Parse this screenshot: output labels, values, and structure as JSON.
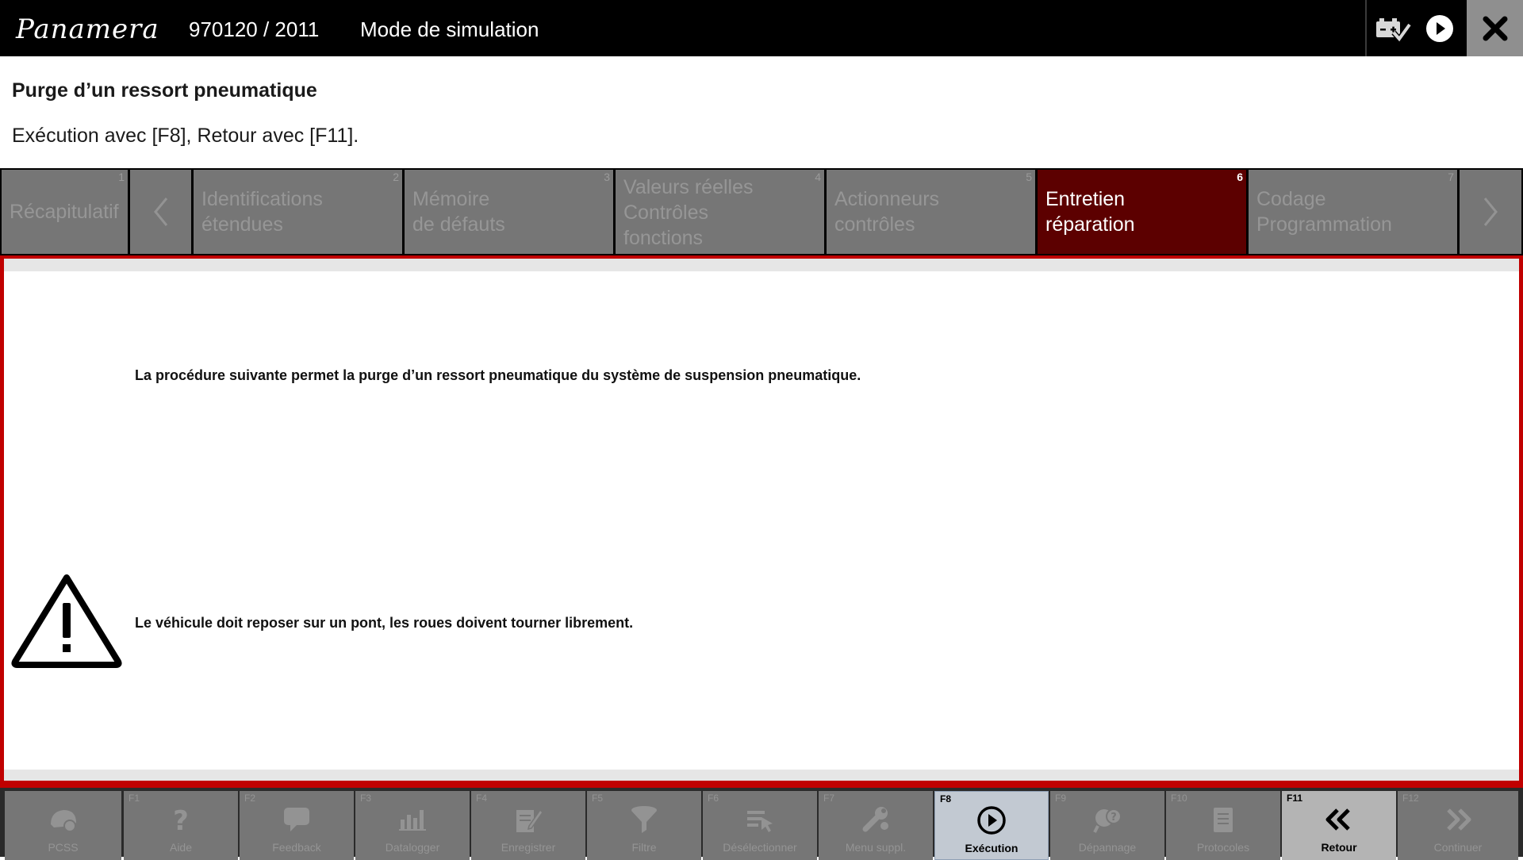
{
  "header": {
    "model_logo": "Panamera",
    "vehicle_id": "970120 / 2011",
    "mode": "Mode de simulation",
    "icons": [
      "battery-check-icon",
      "play-icon",
      "close-icon"
    ]
  },
  "page": {
    "title": "Purge d’un ressort pneumatique",
    "instruction": "Exécution avec [F8], Retour avec [F11]."
  },
  "tabs": [
    {
      "num": "1",
      "label": "Récapitulatif",
      "active": false
    },
    {
      "num": "2",
      "label": "Identifications\nétendues",
      "active": false
    },
    {
      "num": "3",
      "label": "Mémoire\nde défauts",
      "active": false
    },
    {
      "num": "4",
      "label": "Valeurs réelles\nContrôles\nfonctions",
      "active": false
    },
    {
      "num": "5",
      "label": "Actionneurs\ncontrôles",
      "active": false
    },
    {
      "num": "6",
      "label": "Entretien\nréparation",
      "active": true
    },
    {
      "num": "7",
      "label": "Codage\nProgrammation",
      "active": false
    }
  ],
  "content": {
    "procedure_text": "La procédure suivante permet la purge d’un ressort pneumatique du système de suspension pneumatique.",
    "warning_text": "Le véhicule doit reposer sur un pont, les roues doivent tourner librement."
  },
  "function_keys": [
    {
      "code": "",
      "label": "PCSS",
      "icon": "pcss-icon",
      "enabled": false
    },
    {
      "code": "F1",
      "label": "Aide",
      "icon": "help-icon",
      "enabled": false
    },
    {
      "code": "F2",
      "label": "Feedback",
      "icon": "feedback-icon",
      "enabled": false
    },
    {
      "code": "F3",
      "label": "Datalogger",
      "icon": "datalogger-icon",
      "enabled": false
    },
    {
      "code": "F4",
      "label": "Enregistrer",
      "icon": "save-icon",
      "enabled": false
    },
    {
      "code": "F5",
      "label": "Filtre",
      "icon": "filter-icon",
      "enabled": false
    },
    {
      "code": "F6",
      "label": "Désélectionner",
      "icon": "deselect-icon",
      "enabled": false
    },
    {
      "code": "F7",
      "label": "Menu suppl.",
      "icon": "extra-menu-icon",
      "enabled": false
    },
    {
      "code": "F8",
      "label": "Exécution",
      "icon": "execute-icon",
      "enabled": true
    },
    {
      "code": "F9",
      "label": "Dépannage",
      "icon": "troubleshoot-icon",
      "enabled": false
    },
    {
      "code": "F10",
      "label": "Protocoles",
      "icon": "protocols-icon",
      "enabled": false
    },
    {
      "code": "F11",
      "label": "Retour",
      "icon": "back-icon",
      "enabled": true
    },
    {
      "code": "F12",
      "label": "Continuer",
      "icon": "continue-icon",
      "enabled": false
    }
  ],
  "colors": {
    "active_tab": "#5c0000",
    "frame_red": "#c00000",
    "tab_inactive": "#767676",
    "topbar": "#000000"
  }
}
